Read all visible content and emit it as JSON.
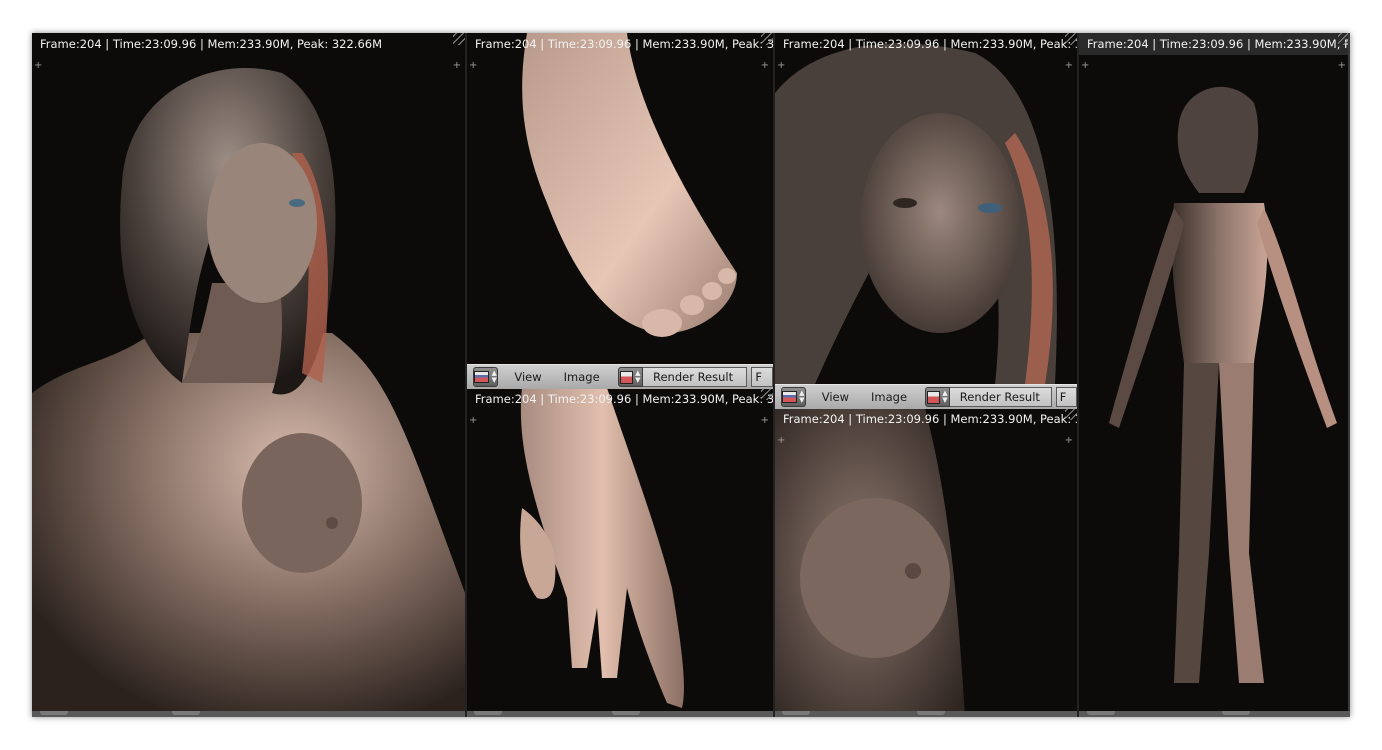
{
  "render_info": "Frame:204 | Time:23:09.96 | Mem:233.90M, Peak: 322.66M",
  "header": {
    "menu_view": "View",
    "menu_image": "Image",
    "image_name": "Render Result",
    "truncated_button": "F"
  },
  "colors": {
    "background": "#0c0b09",
    "skin_light": "#e9c8b6",
    "skin_shadow": "#3a2e28",
    "hair_accent": "#c0624a",
    "header_bg": "#c2c2c2"
  },
  "icons": {
    "editor_type": "image-editor-icon",
    "image_browse": "image-browse-icon",
    "area_corner": "area-split-corner-icon",
    "area_plus": "plus-icon"
  }
}
